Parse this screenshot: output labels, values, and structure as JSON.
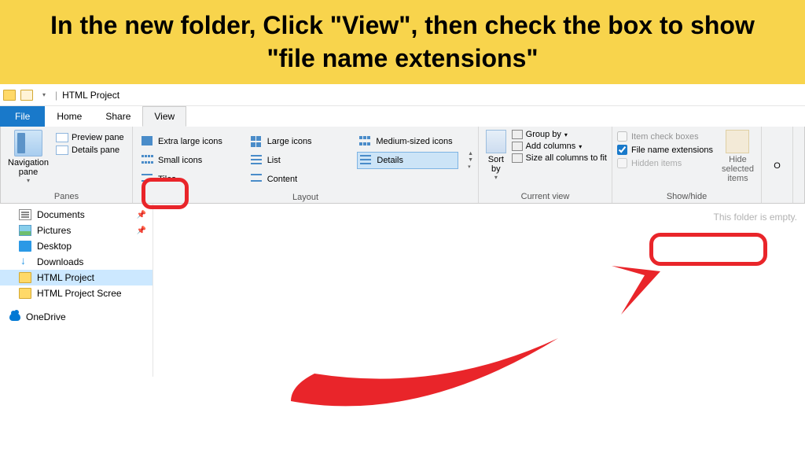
{
  "instruction": "In the new folder, Click \"View\", then check the box to show \"file name extensions\"",
  "window_title": "HTML Project",
  "tabs": {
    "file": "File",
    "home": "Home",
    "share": "Share",
    "view": "View"
  },
  "panes": {
    "label": "Panes",
    "navigation": "Navigation pane",
    "preview": "Preview pane",
    "details": "Details pane"
  },
  "layout": {
    "label": "Layout",
    "extra_large": "Extra large icons",
    "large": "Large icons",
    "medium": "Medium-sized icons",
    "small": "Small icons",
    "list": "List",
    "details": "Details",
    "tiles": "Tiles",
    "content": "Content"
  },
  "current_view": {
    "label": "Current view",
    "sort": "Sort by",
    "group": "Group by",
    "add_cols": "Add columns",
    "size_cols": "Size all columns to fit"
  },
  "show_hide": {
    "label": "Show/hide",
    "item_check": "Item check boxes",
    "file_ext": "File name extensions",
    "hidden": "Hidden items",
    "hide_btn": "Hide selected items"
  },
  "options_label": "O",
  "sidebar": {
    "documents": "Documents",
    "pictures": "Pictures",
    "desktop": "Desktop",
    "downloads": "Downloads",
    "html_project": "HTML Project",
    "html_scree": "HTML Project Scree",
    "onedrive": "OneDrive"
  },
  "empty_text": "This folder is empty."
}
